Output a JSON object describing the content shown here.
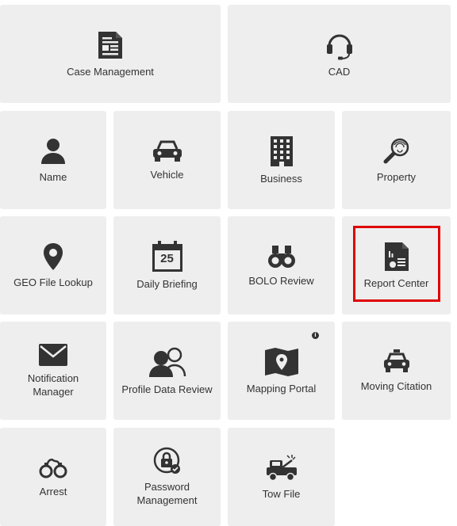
{
  "tiles": {
    "case_management": {
      "label": "Case Management",
      "icon": "document-icon"
    },
    "cad": {
      "label": "CAD",
      "icon": "headset-icon"
    },
    "name": {
      "label": "Name",
      "icon": "person-icon"
    },
    "vehicle": {
      "label": "Vehicle",
      "icon": "car-icon"
    },
    "business": {
      "label": "Business",
      "icon": "building-icon"
    },
    "property": {
      "label": "Property",
      "icon": "fingerprint-magnifier-icon"
    },
    "geo_file_lookup": {
      "label": "GEO File Lookup",
      "icon": "map-pin-icon"
    },
    "daily_briefing": {
      "label": "Daily Briefing",
      "icon": "calendar-icon",
      "calendar_day": "25"
    },
    "bolo_review": {
      "label": "BOLO Review",
      "icon": "binoculars-icon"
    },
    "report_center": {
      "label": "Report Center",
      "icon": "report-chart-icon"
    },
    "notification_manager": {
      "label": "Notification Manager",
      "icon": "envelope-icon"
    },
    "profile_data_review": {
      "label": "Profile Data Review",
      "icon": "users-icon"
    },
    "mapping_portal": {
      "label": "Mapping Portal",
      "icon": "map-icon",
      "badge": "i"
    },
    "moving_citation": {
      "label": "Moving Citation",
      "icon": "police-car-icon"
    },
    "arrest": {
      "label": "Arrest",
      "icon": "handcuffs-icon"
    },
    "password_management": {
      "label": "Password Management",
      "icon": "lock-check-icon"
    },
    "tow_file": {
      "label": "Tow File",
      "icon": "tow-truck-icon"
    }
  },
  "colors": {
    "tile_bg": "#eeeeee",
    "icon": "#333333",
    "highlight": "#e00000"
  }
}
